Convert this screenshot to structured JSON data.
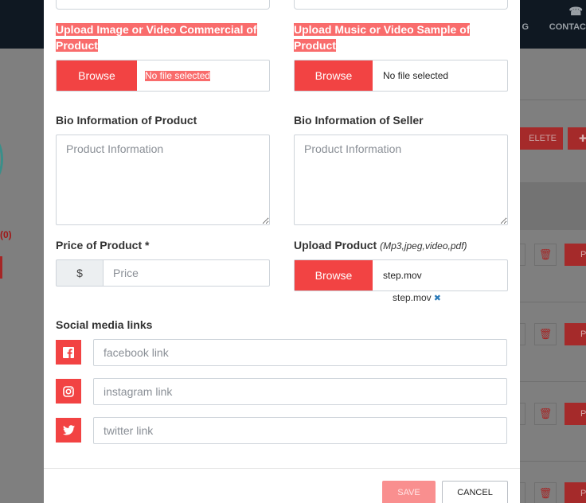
{
  "background": {
    "nav": {
      "blog_label": "G",
      "contact_label": "CONTAC"
    },
    "count_badge": "(0)",
    "delete_label": "ELETE",
    "row_button_label": "P"
  },
  "upload_media": {
    "label": "Upload Image or Video Commercial of Product",
    "browse_label": "Browse",
    "file_status": "No file selected"
  },
  "upload_music": {
    "label": "Upload Music or Video Sample of Product",
    "browse_label": "Browse",
    "file_status": "No file selected"
  },
  "bio_product": {
    "label": "Bio Information of Product",
    "placeholder": "Product Information"
  },
  "bio_seller": {
    "label": "Bio Information of Seller",
    "placeholder": "Product Information"
  },
  "price": {
    "label": "Price of Product *",
    "currency_symbol": "$",
    "placeholder": "Price"
  },
  "upload_product": {
    "label": "Upload Product",
    "hint": "(Mp3,jpeg,video,pdf)",
    "browse_label": "Browse",
    "file_name": "step.mov",
    "uploaded_file": "step.mov",
    "remove_glyph": "✖"
  },
  "social": {
    "heading": "Social media links",
    "facebook_placeholder": "facebook link",
    "instagram_placeholder": "instagram link",
    "twitter_placeholder": "twitter link"
  },
  "footer": {
    "save_label": "SAVE",
    "cancel_label": "CANCEL"
  },
  "colors": {
    "accent": "#f24343",
    "highlight": "#f96c6c",
    "save_disabled": "#f98f8f"
  }
}
